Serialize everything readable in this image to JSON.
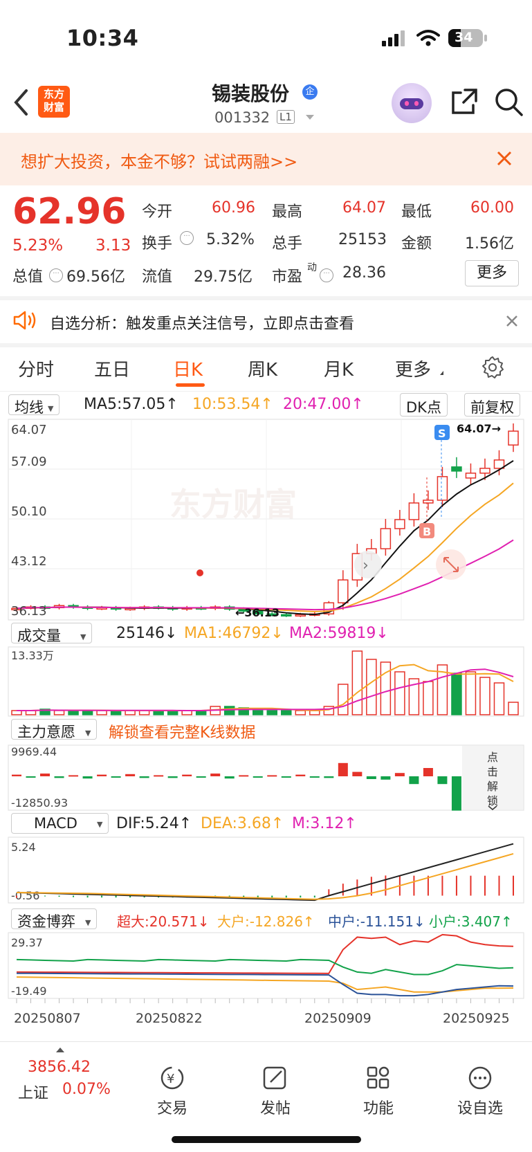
{
  "status": {
    "time": "10:34",
    "battery": "34"
  },
  "header": {
    "app_logo": "东方\n财富",
    "stock_name": "锡装股份",
    "badge": "企",
    "code": "001332",
    "level": "L1"
  },
  "banner": {
    "text": "想扩大投资，本金不够？试试两融>>"
  },
  "quote": {
    "price": "62.96",
    "change_pct": "5.23%",
    "change": "3.13",
    "open_label": "今开",
    "open": "60.96",
    "high_label": "最高",
    "high": "64.07",
    "low_label": "最低",
    "low": "60.00",
    "turnover_label": "换手",
    "turnover": "5.32%",
    "volume_label": "总手",
    "volume": "25153",
    "amount_label": "金额",
    "amount": "1.56亿",
    "mcap_label": "总值",
    "mcap": "69.56亿",
    "float_label": "流值",
    "float": "29.75亿",
    "pe_label": "市盈",
    "pe_sup": "动",
    "pe": "28.36",
    "more": "更多"
  },
  "notice": {
    "text": "自选分析：触发重点关注信号，立即点击查看"
  },
  "tabs": [
    "分时",
    "五日",
    "日K",
    "周K",
    "月K",
    "更多"
  ],
  "chart_toolbar": {
    "indicator": "均线",
    "ma5": "MA5:57.05↑",
    "ma10": "10:53.54↑",
    "ma20": "20:47.00↑",
    "dk": "DK点",
    "adjust": "前复权",
    "y_max": "64.07",
    "y_2": "57.09",
    "y_3": "50.10",
    "y_4": "43.12",
    "y_min": "36.13",
    "high_mark": "64.07→",
    "low_mark": "←36.13",
    "signal_s": "S",
    "signal_b": "B",
    "watermark": "东方财富"
  },
  "volume_panel": {
    "indicator": "成交量",
    "vol": "25146↓",
    "ma1": "MA1:46792↓",
    "ma2": "MA2:59819↓",
    "y_max": "13.33万"
  },
  "main_force_panel": {
    "indicator": "主力意愿",
    "hint": "解锁查看完整K线数据",
    "y_max": "9969.44",
    "y_min": "-12850.93",
    "unlock": [
      "点",
      "击",
      "解",
      "锁"
    ]
  },
  "macd_panel": {
    "indicator": "MACD",
    "dif": "DIF:5.24↑",
    "dea": "DEA:3.68↑",
    "m": "M:3.12↑",
    "y_max": "5.24",
    "y_min": "-0.56"
  },
  "fund_panel": {
    "indicator": "资金博弈",
    "super": "超大:20.571↓",
    "large": "大户:-12.826↑",
    "mid": "中户:-11.151↓",
    "small": "小户:3.407↑",
    "y_max": "29.37",
    "y_min": "-19.49"
  },
  "x_axis": [
    "20250807",
    "20250822",
    "20250909",
    "20250925"
  ],
  "bottom_bar": {
    "index_value": "3856.42",
    "index_name": "上证",
    "index_change": "0.07%",
    "items": [
      "交易",
      "发帖",
      "功能",
      "设自选"
    ]
  },
  "chart_data": {
    "type": "candlestick",
    "x_range": [
      "20250807",
      "20250925"
    ],
    "price_range": [
      36.13,
      64.07
    ],
    "last_close": 62.96,
    "high": 64.07,
    "low": 36.13,
    "ma5": 57.05,
    "ma10": 53.54,
    "ma20": 47.0,
    "volume_range_max": "13.33万",
    "macd": {
      "dif": 5.24,
      "dea": 3.68,
      "m": 3.12,
      "range": [
        -0.56,
        5.24
      ]
    },
    "fund_flow": {
      "super": 20.571,
      "large": -12.826,
      "mid": -11.151,
      "small": 3.407,
      "range": [
        -19.49,
        29.37
      ]
    }
  },
  "colors": {
    "up": "#e5332a",
    "down": "#12a24a",
    "accent": "#ff6a00",
    "ma10": "#f5a623",
    "ma20": "#e020b0"
  }
}
